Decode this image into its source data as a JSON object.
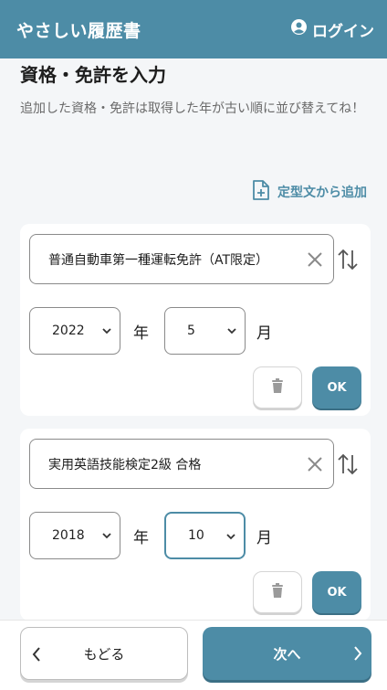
{
  "header": {
    "app_title": "やさしい履歴書",
    "login_label": "ログイン"
  },
  "page": {
    "title": "資格・免許を入力",
    "description": "追加した資格・免許は取得した年が古い順に並び替えてね！",
    "template_link_label": "定型文から追加"
  },
  "entries": [
    {
      "name": "普通自動車第一種運転免許（AT限定）",
      "year": "2022",
      "month": "5",
      "year_unit": "年",
      "month_unit": "月",
      "ok_label": "OK"
    },
    {
      "name": "実用英語技能検定2級 合格",
      "year": "2018",
      "month": "10",
      "year_unit": "年",
      "month_unit": "月",
      "ok_label": "OK"
    }
  ],
  "footer": {
    "back_label": "もどる",
    "next_label": "次へ"
  },
  "colors": {
    "accent": "#4d8ca6",
    "background": "#f4f6f8"
  },
  "icons": [
    "user-circle-icon",
    "file-plus-icon",
    "clear-x-icon",
    "sort-arrows-icon",
    "chevron-down-icon",
    "trash-icon",
    "chevron-left-icon",
    "chevron-right-icon"
  ]
}
